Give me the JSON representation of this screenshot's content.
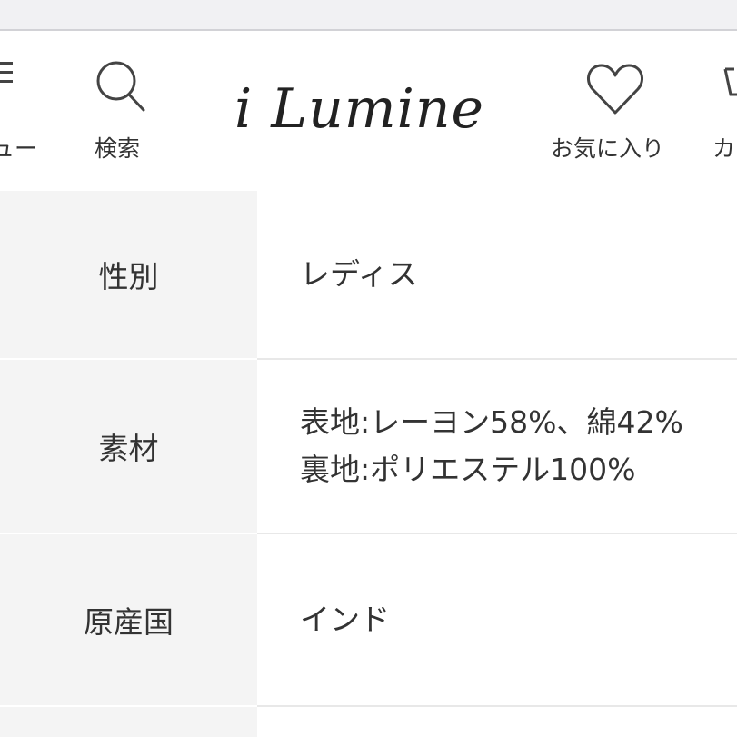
{
  "header": {
    "menu_label": "ニュー",
    "search_label": "検索",
    "logo_text": "i Lumine",
    "favorites_label": "お気に入り",
    "cart_label": "カ"
  },
  "specs": [
    {
      "key": "性別",
      "values": [
        "レディス"
      ]
    },
    {
      "key": "素材",
      "values": [
        "表地:レーヨン58%、綿42%",
        "裏地:ポリエステル100%"
      ]
    },
    {
      "key": "原産国",
      "values": [
        "インド"
      ]
    }
  ]
}
